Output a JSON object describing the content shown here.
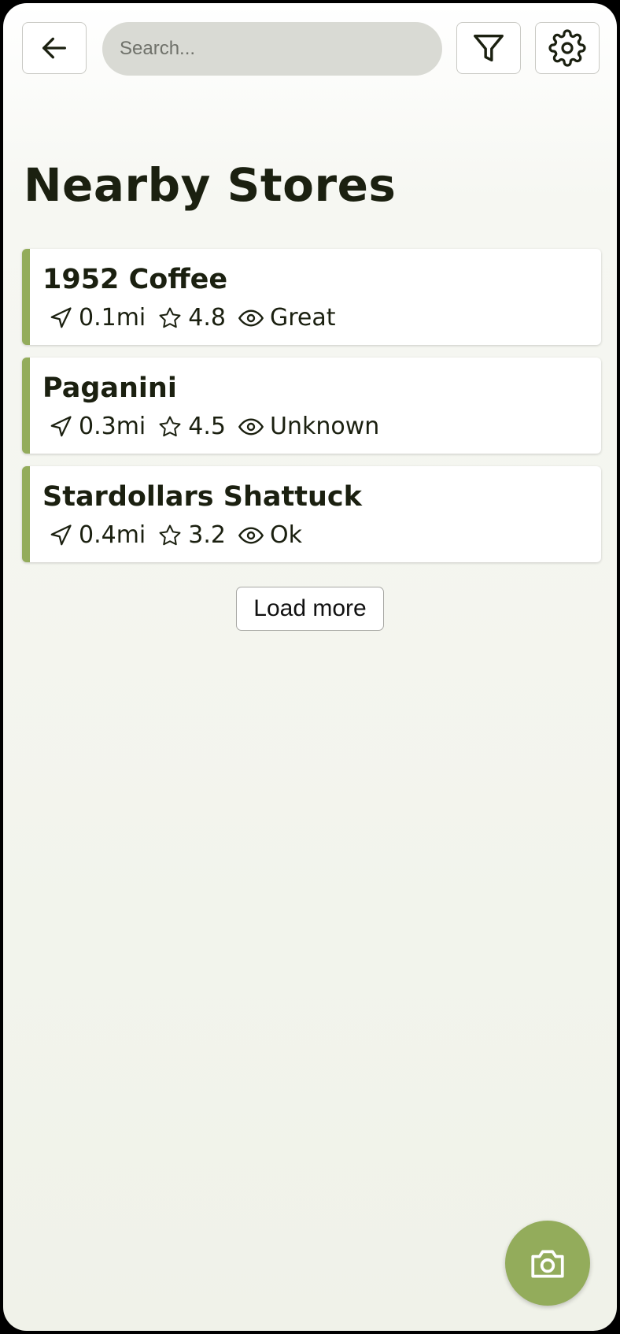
{
  "header": {
    "search_placeholder": "Search..."
  },
  "page": {
    "title": "Nearby Stores"
  },
  "stores": [
    {
      "name": "1952 Coffee",
      "distance": "0.1mi",
      "rating": "4.8",
      "visibility": "Great"
    },
    {
      "name": "Paganini",
      "distance": "0.3mi",
      "rating": "4.5",
      "visibility": "Unknown"
    },
    {
      "name": "Stardollars Shattuck",
      "distance": "0.4mi",
      "rating": "3.2",
      "visibility": "Ok"
    }
  ],
  "actions": {
    "load_more_label": "Load more"
  },
  "icons": {
    "back": "arrow-left-icon",
    "filter": "filter-icon",
    "settings": "gear-icon",
    "distance": "navigation-arrow-icon",
    "rating": "star-icon",
    "visibility": "eye-icon",
    "camera": "camera-icon"
  },
  "colors": {
    "accent": "#93ac5b",
    "text": "#1b2010",
    "search_bg": "#d9dad4"
  }
}
